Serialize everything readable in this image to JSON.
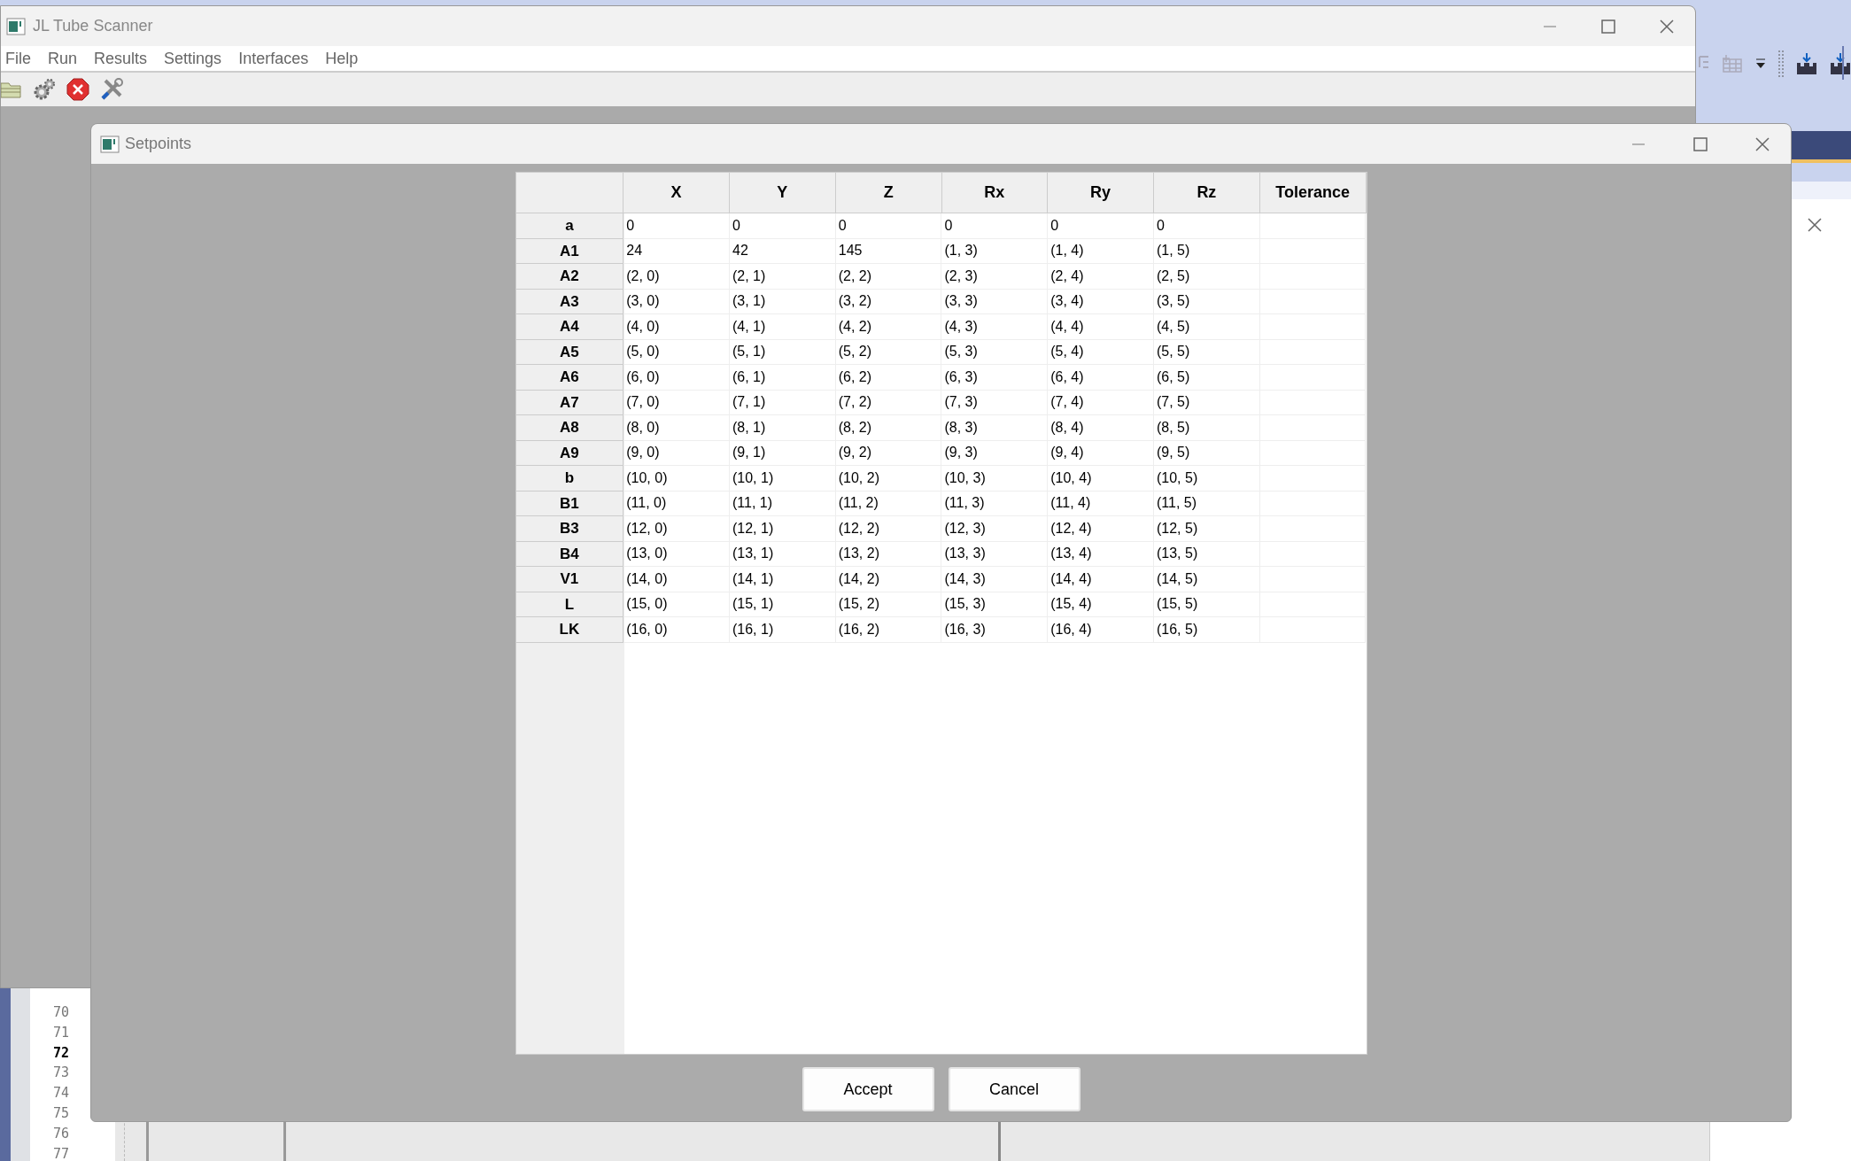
{
  "main_window": {
    "title": "JL Tube Scanner",
    "menu": [
      "File",
      "Run",
      "Results",
      "Settings",
      "Interfaces",
      "Help"
    ]
  },
  "dialog": {
    "title": "Setpoints",
    "table": {
      "columns": [
        "X",
        "Y",
        "Z",
        "Rx",
        "Ry",
        "Rz",
        "Tolerance"
      ],
      "rows": [
        {
          "header": "a",
          "cells": [
            "0",
            "0",
            "0",
            "0",
            "0",
            "0"
          ]
        },
        {
          "header": "A1",
          "cells": [
            "24",
            "42",
            "145",
            "(1, 3)",
            "(1, 4)",
            "(1, 5)"
          ]
        },
        {
          "header": "A2",
          "cells": [
            "(2, 0)",
            "(2, 1)",
            "(2, 2)",
            "(2, 3)",
            "(2, 4)",
            "(2, 5)"
          ]
        },
        {
          "header": "A3",
          "cells": [
            "(3, 0)",
            "(3, 1)",
            "(3, 2)",
            "(3, 3)",
            "(3, 4)",
            "(3, 5)"
          ]
        },
        {
          "header": "A4",
          "cells": [
            "(4, 0)",
            "(4, 1)",
            "(4, 2)",
            "(4, 3)",
            "(4, 4)",
            "(4, 5)"
          ]
        },
        {
          "header": "A5",
          "cells": [
            "(5, 0)",
            "(5, 1)",
            "(5, 2)",
            "(5, 3)",
            "(5, 4)",
            "(5, 5)"
          ]
        },
        {
          "header": "A6",
          "cells": [
            "(6, 0)",
            "(6, 1)",
            "(6, 2)",
            "(6, 3)",
            "(6, 4)",
            "(6, 5)"
          ]
        },
        {
          "header": "A7",
          "cells": [
            "(7, 0)",
            "(7, 1)",
            "(7, 2)",
            "(7, 3)",
            "(7, 4)",
            "(7, 5)"
          ]
        },
        {
          "header": "A8",
          "cells": [
            "(8, 0)",
            "(8, 1)",
            "(8, 2)",
            "(8, 3)",
            "(8, 4)",
            "(8, 5)"
          ]
        },
        {
          "header": "A9",
          "cells": [
            "(9, 0)",
            "(9, 1)",
            "(9, 2)",
            "(9, 3)",
            "(9, 4)",
            "(9, 5)"
          ]
        },
        {
          "header": "b",
          "cells": [
            "(10, 0)",
            "(10, 1)",
            "(10, 2)",
            "(10, 3)",
            "(10, 4)",
            "(10, 5)"
          ]
        },
        {
          "header": "B1",
          "cells": [
            "(11, 0)",
            "(11, 1)",
            "(11, 2)",
            "(11, 3)",
            "(11, 4)",
            "(11, 5)"
          ]
        },
        {
          "header": "B3",
          "cells": [
            "(12, 0)",
            "(12, 1)",
            "(12, 2)",
            "(12, 3)",
            "(12, 4)",
            "(12, 5)"
          ]
        },
        {
          "header": "B4",
          "cells": [
            "(13, 0)",
            "(13, 1)",
            "(13, 2)",
            "(13, 3)",
            "(13, 4)",
            "(13, 5)"
          ]
        },
        {
          "header": "V1",
          "cells": [
            "(14, 0)",
            "(14, 1)",
            "(14, 2)",
            "(14, 3)",
            "(14, 4)",
            "(14, 5)"
          ]
        },
        {
          "header": "L",
          "cells": [
            "(15, 0)",
            "(15, 1)",
            "(15, 2)",
            "(15, 3)",
            "(15, 4)",
            "(15, 5)"
          ]
        },
        {
          "header": "LK",
          "cells": [
            "(16, 0)",
            "(16, 1)",
            "(16, 2)",
            "(16, 3)",
            "(16, 4)",
            "(16, 5)"
          ]
        }
      ]
    },
    "buttons": [
      "Accept",
      "Cancel"
    ]
  },
  "editor": {
    "line_numbers": [
      {
        "text": "70",
        "current": false
      },
      {
        "text": "71",
        "current": false
      },
      {
        "text": "72",
        "current": true
      },
      {
        "text": "73",
        "current": false
      },
      {
        "text": "74",
        "current": false
      },
      {
        "text": "75",
        "current": false
      },
      {
        "text": "76",
        "current": false
      },
      {
        "text": "77",
        "current": false
      }
    ]
  }
}
